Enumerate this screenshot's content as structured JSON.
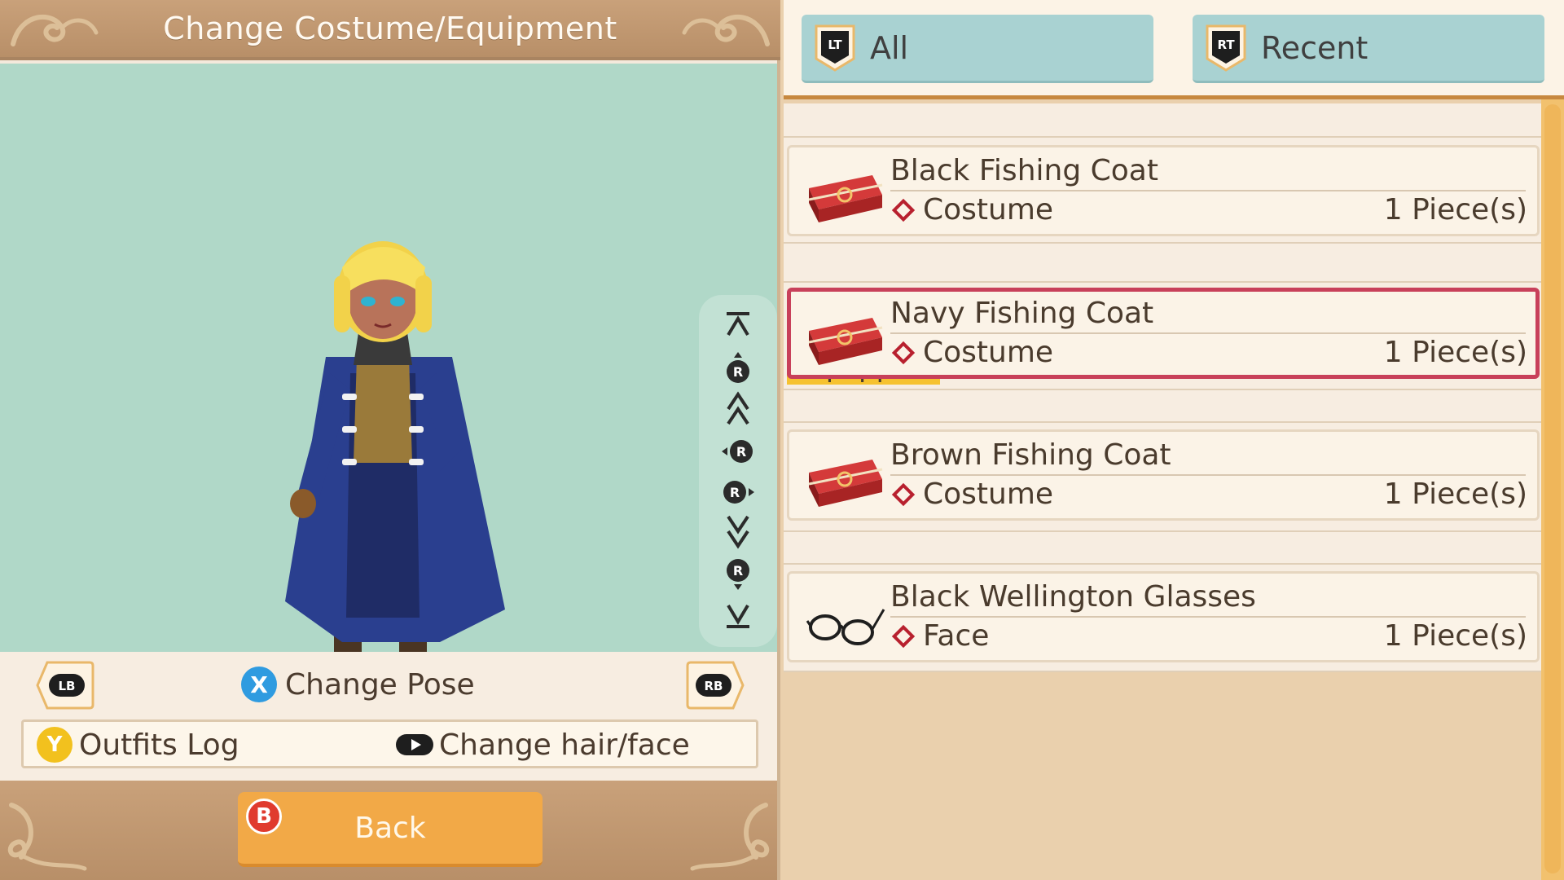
{
  "header": {
    "title": "Change Costume/Equipment"
  },
  "controls": {
    "lb": "LB",
    "rb": "RB",
    "x_button": "X",
    "change_pose": "Change Pose",
    "y_button": "Y",
    "outfits_log": "Outfits Log",
    "change_hair_face": "Change hair/face"
  },
  "rotation_icons": [
    "top-arrow-icon",
    "r-stick-up-icon",
    "double-up-icon",
    "r-stick-left-icon",
    "r-stick-right-icon",
    "double-down-icon",
    "r-stick-down-icon",
    "bottom-arrow-icon"
  ],
  "stick_letter": "R",
  "footer": {
    "b_button": "B",
    "back": "Back"
  },
  "tabs": [
    {
      "badge": "LT",
      "label": "All"
    },
    {
      "badge": "RT",
      "label": "Recent"
    }
  ],
  "equipped_label": "Equipped",
  "items": [
    {
      "name": "Black Fishing Coat",
      "category": "Costume",
      "quantity": "1 Piece(s)",
      "icon": "costume-case-icon",
      "selected": false
    },
    {
      "name": "Navy Fishing Coat",
      "category": "Costume",
      "quantity": "1 Piece(s)",
      "icon": "costume-case-icon",
      "selected": true
    },
    {
      "name": "Brown Fishing Coat",
      "category": "Costume",
      "quantity": "1 Piece(s)",
      "icon": "costume-case-icon",
      "selected": false
    },
    {
      "name": "Black Wellington Glasses",
      "category": "Face",
      "quantity": "1 Piece(s)",
      "icon": "glasses-icon",
      "selected": false
    }
  ],
  "colors": {
    "viewport": "#b0d8c8",
    "tab": "#a9d2d2",
    "back_button": "#f2a947",
    "selected_border": "#c8405a",
    "equipped_tag": "#f6c230"
  }
}
